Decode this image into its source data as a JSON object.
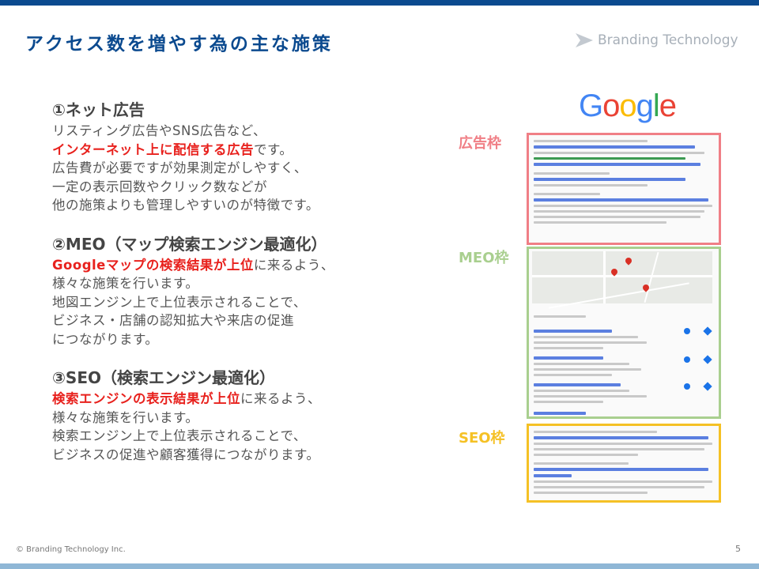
{
  "header": {
    "title": "アクセス数を増やす為の主な施策",
    "brand": "Branding Technology"
  },
  "sections": [
    {
      "heading": "①ネット広告",
      "lines": [
        [
          {
            "t": "リスティング広告やSNS広告など、",
            "hl": false
          }
        ],
        [
          {
            "t": "インターネット上に配信する広告",
            "hl": true
          },
          {
            "t": "です。",
            "hl": false
          }
        ],
        [
          {
            "t": "広告費が必要ですが効果測定がしやすく、",
            "hl": false
          }
        ],
        [
          {
            "t": "一定の表示回数やクリック数などが",
            "hl": false
          }
        ],
        [
          {
            "t": "他の施策よりも管理しやすいのが特徴です。",
            "hl": false
          }
        ]
      ]
    },
    {
      "heading": "②MEO（マップ検索エンジン最適化）",
      "lines": [
        [
          {
            "t": "Googleマップの検索結果が上位",
            "hl": true
          },
          {
            "t": "に来るよう、",
            "hl": false
          }
        ],
        [
          {
            "t": "様々な施策を行います。",
            "hl": false
          }
        ],
        [
          {
            "t": "地図エンジン上で上位表示されることで、",
            "hl": false
          }
        ],
        [
          {
            "t": "ビジネス・店舗の認知拡大や来店の促進",
            "hl": false
          }
        ],
        [
          {
            "t": "につながります。",
            "hl": false
          }
        ]
      ]
    },
    {
      "heading": "③SEO（検索エンジン最適化）",
      "lines": [
        [
          {
            "t": "検索エンジンの表示結果が上位",
            "hl": true
          },
          {
            "t": "に来るよう、",
            "hl": false
          }
        ],
        [
          {
            "t": "様々な施策を行います。",
            "hl": false
          }
        ],
        [
          {
            "t": "検索エンジン上で上位表示されることで、",
            "hl": false
          }
        ],
        [
          {
            "t": "ビジネスの促進や顧客獲得につながります。",
            "hl": false
          }
        ]
      ]
    }
  ],
  "illustration": {
    "logo_letters": [
      {
        "ch": "G",
        "color": "#4285F4"
      },
      {
        "ch": "o",
        "color": "#EA4335"
      },
      {
        "ch": "o",
        "color": "#FBBC05"
      },
      {
        "ch": "g",
        "color": "#4285F4"
      },
      {
        "ch": "l",
        "color": "#34A853"
      },
      {
        "ch": "e",
        "color": "#EA4335"
      }
    ],
    "labels": {
      "ad": {
        "text": "広告枠",
        "color": "#f07f86"
      },
      "meo": {
        "text": "MEO枠",
        "color": "#a9cf8f"
      },
      "seo": {
        "text": "SEO枠",
        "color": "#f5c125"
      }
    }
  },
  "footer": {
    "copyright": "© Branding Technology Inc.",
    "page_number": "5"
  }
}
